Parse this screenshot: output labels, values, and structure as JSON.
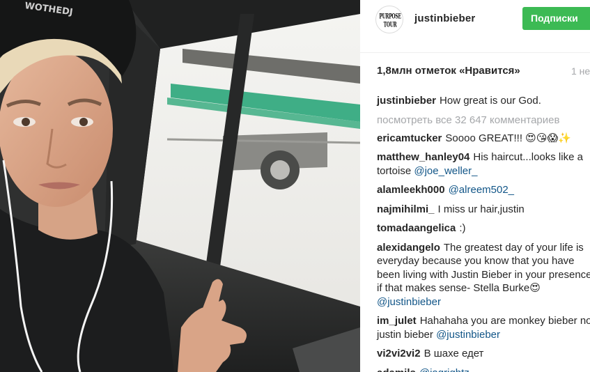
{
  "post": {
    "author": "justinbieber",
    "avatar_logo_text": "PURPOSE TOUR",
    "follow_label": "Подписки",
    "likes_text": "1,8млн отметок «Нравится»",
    "time_ago": "1 не",
    "caption": {
      "user": "justinbieber",
      "text": "How great is our God."
    },
    "view_all_comments": "посмотреть все 32 647 комментариев",
    "photo_cap_text": "WOTHEDJ"
  },
  "comments": [
    {
      "user": "ericamtucker",
      "text": "Soooo GREAT!!! 😍😘😱✨",
      "mention": ""
    },
    {
      "user": "matthew_hanley04",
      "text": "His haircut...looks like a tortoise ",
      "mention": "@joe_weller_"
    },
    {
      "user": "alamleekh000",
      "text": "",
      "mention": "@alreem502_"
    },
    {
      "user": "najmihilmi_",
      "text": "I miss ur hair,justin",
      "mention": ""
    },
    {
      "user": "tomadaangelica",
      "text": ":)",
      "mention": ""
    },
    {
      "user": "alexidangelo",
      "text": "The greatest day of your life is everyday because you know that you have been living with Justin Bieber in your presence, if that makes sense- Stella Burke😍 ",
      "mention": "@justinbieber"
    },
    {
      "user": "im_julet",
      "text": "Hahahaha you are monkey bieber not justin bieber ",
      "mention": "@justinbieber"
    },
    {
      "user": "vi2vi2vi2",
      "text": "В шахе едет",
      "mention": ""
    },
    {
      "user": "adamils",
      "text": "",
      "mention": "@jagrightz"
    }
  ],
  "colors": {
    "follow_button": "#3cba54",
    "mention": "#125688",
    "muted": "#a5a7aa"
  }
}
